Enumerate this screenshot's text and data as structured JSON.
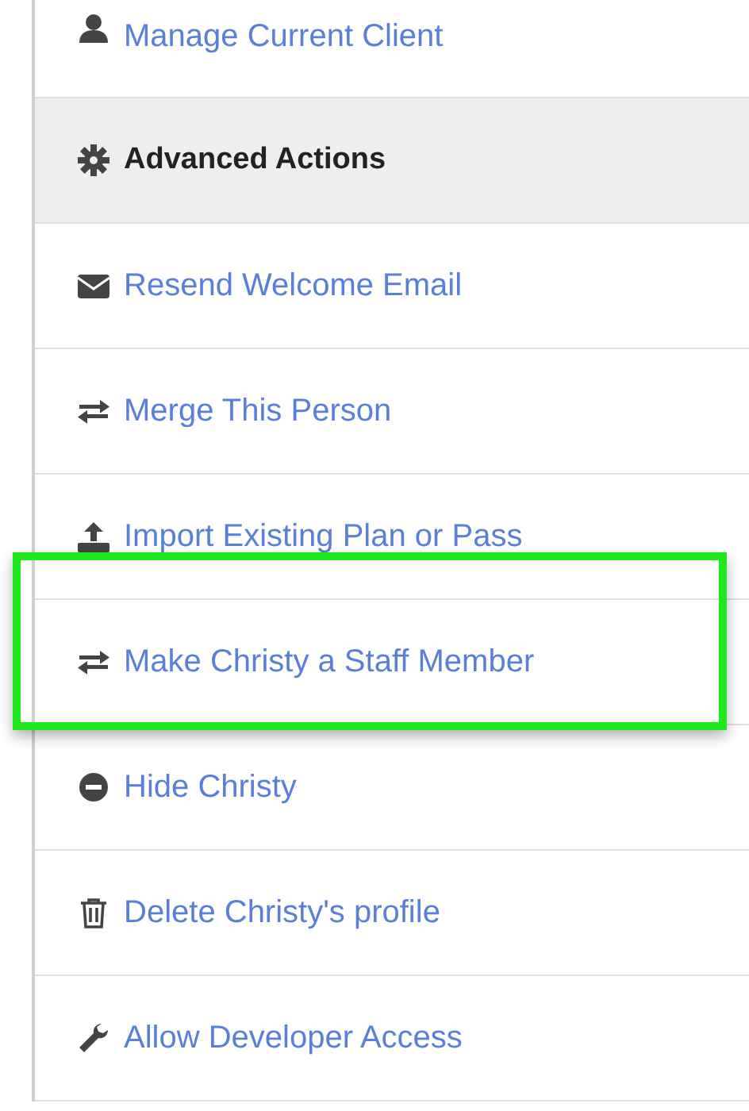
{
  "items": [
    {
      "kind": "link",
      "label": "Manage Current Client",
      "highlighted": false
    },
    {
      "kind": "header",
      "label": "Advanced Actions",
      "highlighted": false
    },
    {
      "kind": "link",
      "label": "Resend Welcome Email",
      "highlighted": false
    },
    {
      "kind": "link",
      "label": "Merge This Person",
      "highlighted": false
    },
    {
      "kind": "link",
      "label": "Import Existing Plan or Pass",
      "highlighted": false
    },
    {
      "kind": "link",
      "label": "Make Christy a Staff Member",
      "highlighted": true
    },
    {
      "kind": "link",
      "label": "Hide Christy",
      "highlighted": false
    },
    {
      "kind": "link",
      "label": "Delete Christy's profile",
      "highlighted": false
    },
    {
      "kind": "link",
      "label": "Allow Developer Access",
      "highlighted": false
    }
  ]
}
